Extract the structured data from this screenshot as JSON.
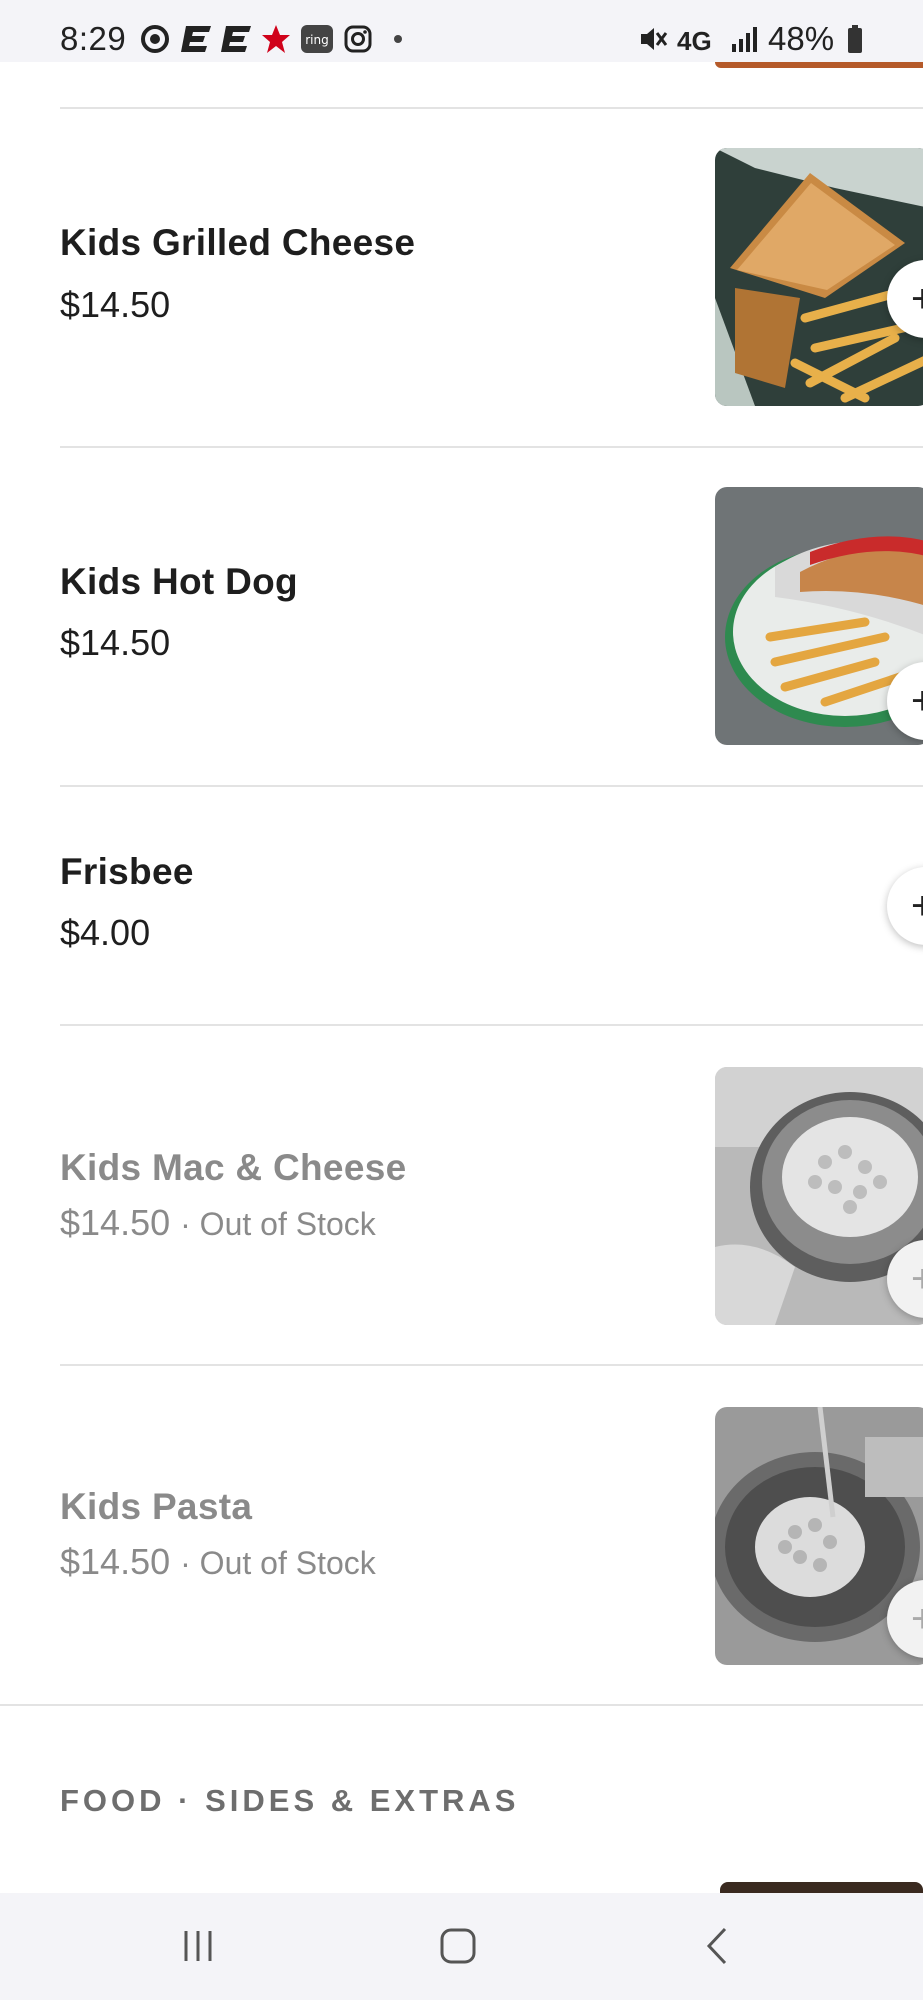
{
  "status_bar": {
    "time": "8:29",
    "network": "4G",
    "battery": "48%",
    "icons": [
      "target-icon",
      "espn-icon",
      "espn-icon",
      "macys-star-icon",
      "ring-icon",
      "instagram-icon",
      "dot-icon",
      "mute-icon",
      "signal-icon",
      "battery-icon"
    ]
  },
  "menu": {
    "items": [
      {
        "name": "Kids Grilled Cheese",
        "price": "$14.50",
        "status": "",
        "image": "grilled-cheese-and-fries",
        "add_icon": "plus-icon"
      },
      {
        "name": "Kids Hot Dog",
        "price": "$14.50",
        "status": "",
        "image": "hot-dog-and-fries",
        "add_icon": "plus-icon"
      },
      {
        "name": "Frisbee",
        "price": "$4.00",
        "status": "",
        "image": "",
        "add_icon": "plus-icon"
      },
      {
        "name": "Kids Mac & Cheese",
        "price": "$14.50",
        "status": "· Out of Stock",
        "image": "mac-and-cheese",
        "add_icon": "plus-icon"
      },
      {
        "name": "Kids Pasta",
        "price": "$14.50",
        "status": "· Out of Stock",
        "image": "pasta-bowl",
        "add_icon": "plus-icon"
      }
    ],
    "next_section": "FOOD · SIDES & EXTRAS"
  },
  "nav_bar": {
    "icons": [
      "recent-apps-icon",
      "home-icon",
      "back-icon"
    ]
  },
  "colors": {
    "status_bar_bg": "#f4f4f8",
    "text_primary": "#1e1e1e",
    "text_disabled": "#8a8a8a",
    "divider": "#e3e3e3",
    "macys_red": "#d0021b"
  }
}
